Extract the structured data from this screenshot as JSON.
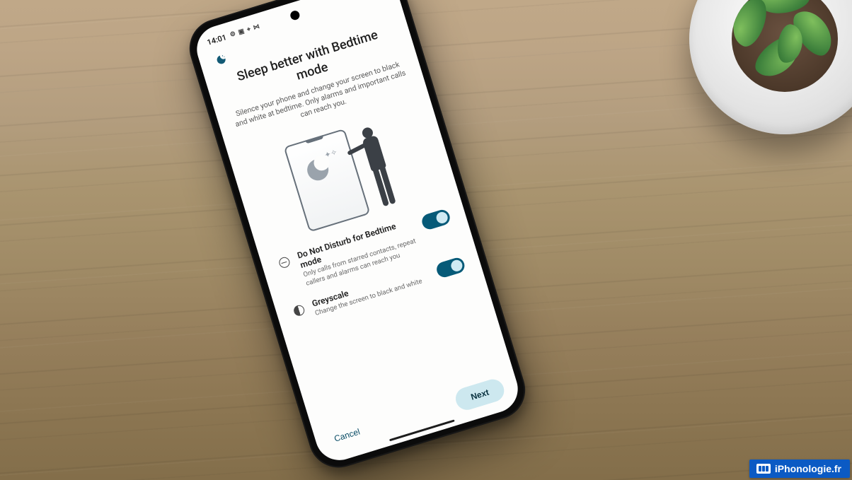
{
  "statusbar": {
    "time": "14:01",
    "left_icons_glyph": "⚙ ▣ ⌖ ⋈"
  },
  "header": {
    "title": "Sleep better with Bedtime mode",
    "subtitle": "Silence your phone and change your screen to black and white at bedtime. Only alarms and important calls can reach you."
  },
  "options": [
    {
      "id": "dnd",
      "title": "Do Not Disturb for Bedtime mode",
      "description": "Only calls from starred contacts, repeat callers and alarms can reach you",
      "enabled": true
    },
    {
      "id": "greyscale",
      "title": "Greyscale",
      "description": "Change the screen to black and white",
      "enabled": true
    }
  ],
  "footer": {
    "cancel": "Cancel",
    "next": "Next"
  },
  "watermark": {
    "text": "iPhonologie.fr"
  },
  "colors": {
    "toggle_on_track": "#065a78",
    "toggle_on_knob": "#cfeaf3",
    "next_button_bg": "#cde8ef"
  }
}
